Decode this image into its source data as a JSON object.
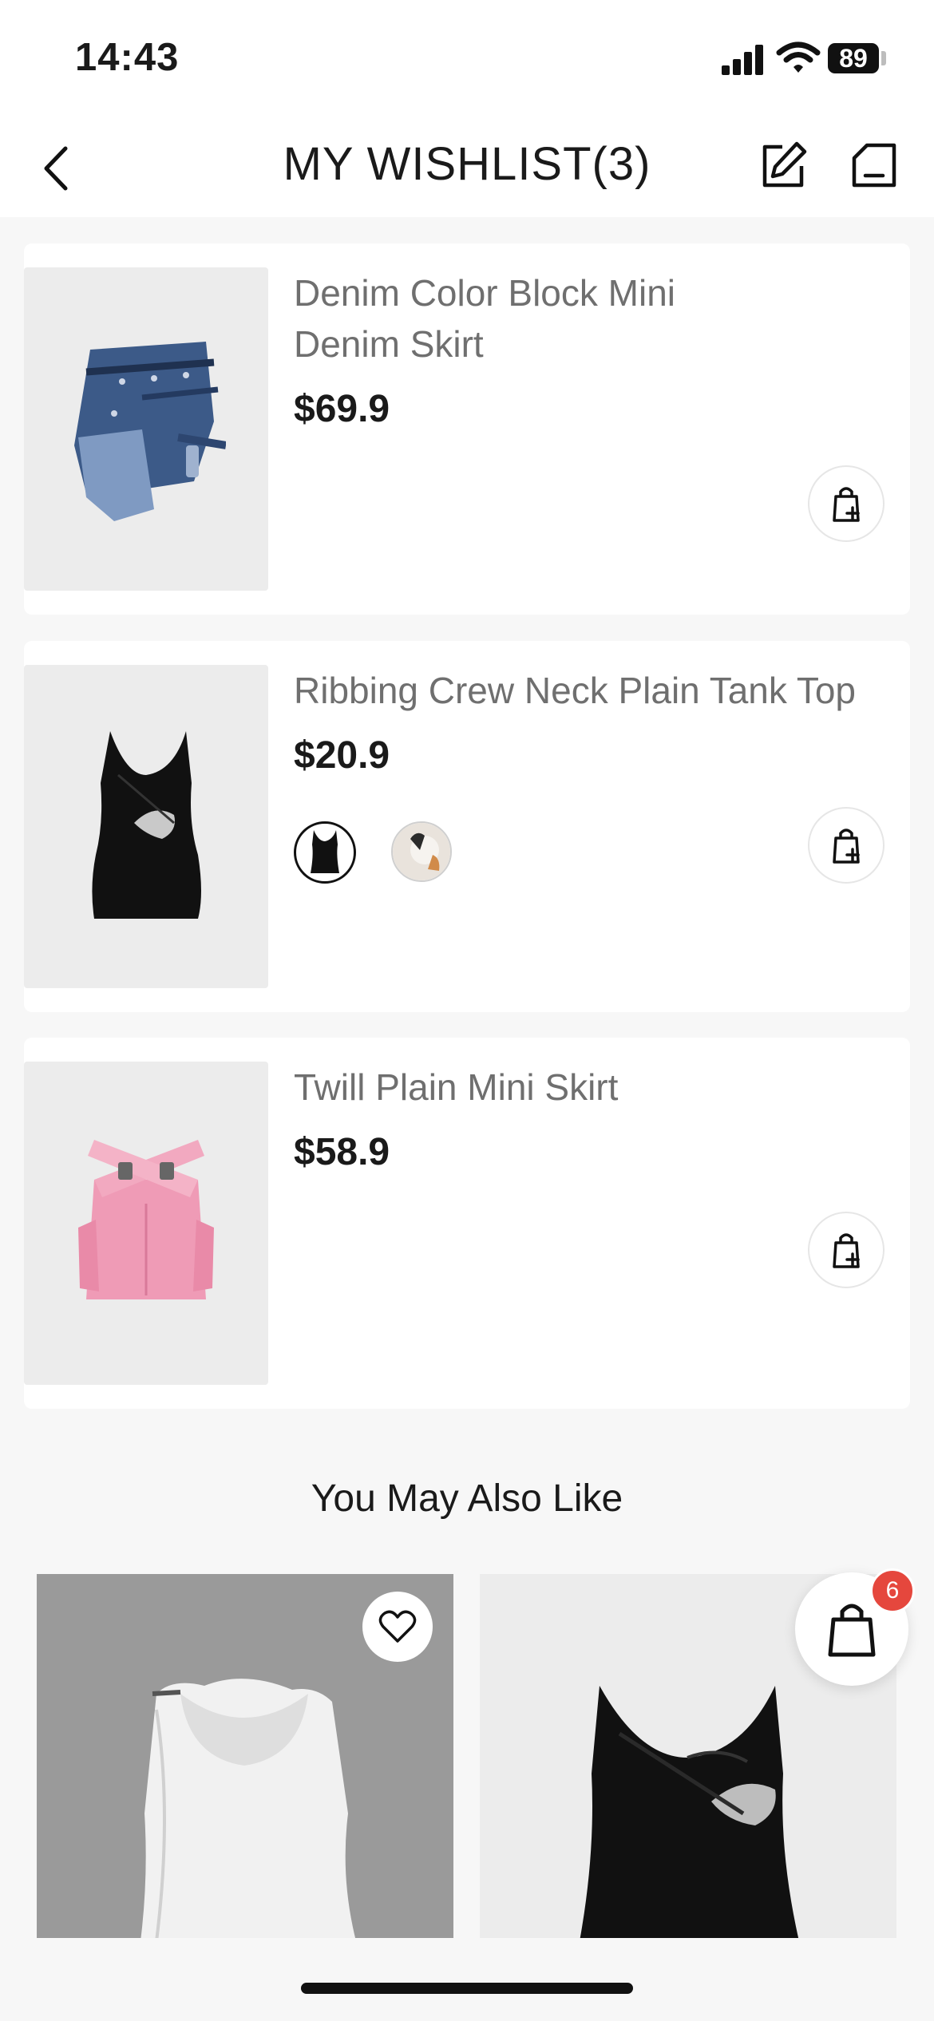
{
  "status_bar": {
    "time": "14:43",
    "battery": "89"
  },
  "header": {
    "title": "MY WISHLIST(3)"
  },
  "wishlist": [
    {
      "name": "Denim Color Block Mini Denim Skirt",
      "price": "$69.9",
      "image_icon": "denim-skirt-image"
    },
    {
      "name": "Ribbing Crew Neck Plain Tank Top",
      "price": "$20.9",
      "image_icon": "black-tank-top-image",
      "swatches": [
        "black-tank-swatch",
        "white-top-swatch"
      ]
    },
    {
      "name": "Twill Plain Mini Skirt",
      "price": "$58.9",
      "image_icon": "pink-skirt-image"
    }
  ],
  "recommendations": {
    "title": "You May Also Like",
    "items": [
      {
        "image_icon": "white-cowl-top-image"
      },
      {
        "image_icon": "black-tank-top-image"
      }
    ]
  },
  "cart": {
    "badge_count": "6"
  },
  "colors": {
    "badge": "#e5473d",
    "card_bg": "#ffffff",
    "page_bg": "#f7f7f7",
    "image_bg": "#ececec"
  }
}
